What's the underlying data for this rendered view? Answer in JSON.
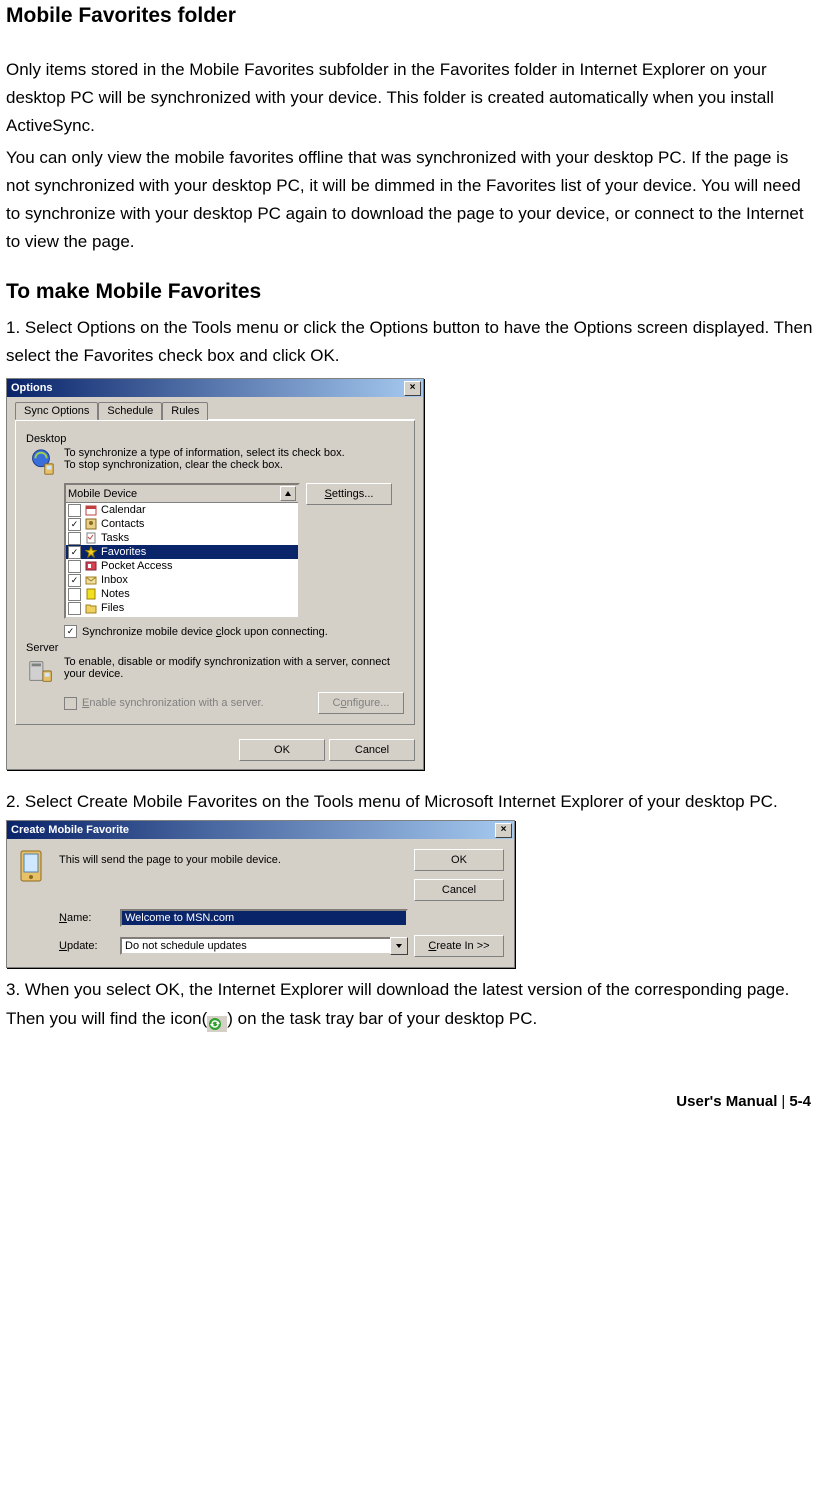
{
  "headings": {
    "title": "Mobile Favorites folder",
    "section2": "To make Mobile Favorites"
  },
  "paragraphs": {
    "p1": "Only items stored in the Mobile Favorites subfolder in the Favorites folder in Internet Explorer on your desktop PC will be synchronized with your device. This folder is created automatically when you install ActiveSync.",
    "p2": "You can only view the mobile favorites offline that was synchronized with your desktop PC. If the page is not synchronized with your desktop PC, it will be dimmed in the Favorites list of your device. You will need to synchronize with your desktop PC again to download the page to your device, or connect to the Internet to view the page.",
    "step1": "1. Select Options on the Tools menu or click the Options button to have the Options screen displayed. Then select the Favorites check box and click OK.",
    "step2": "2. Select Create Mobile Favorites on the Tools menu of Microsoft Internet Explorer of your desktop PC.",
    "step3a": "3. When you select OK, the Internet Explorer will download the latest version of the corresponding page. Then you will find the icon(",
    "step3b": ") on the task tray bar of your desktop PC."
  },
  "optionsDialog": {
    "title": "Options",
    "tabs": [
      "Sync Options",
      "Schedule",
      "Rules"
    ],
    "desktopLabel": "Desktop",
    "desktopText1": "To synchronize a type of information, select its check box.",
    "desktopText2": "To stop synchronization, clear the check box.",
    "listHeader": "Mobile Device",
    "items": [
      {
        "label": "Calendar",
        "checked": false
      },
      {
        "label": "Contacts",
        "checked": true
      },
      {
        "label": "Tasks",
        "checked": false
      },
      {
        "label": "Favorites",
        "checked": true,
        "selected": true
      },
      {
        "label": "Pocket Access",
        "checked": false
      },
      {
        "label": "Inbox",
        "checked": true
      },
      {
        "label": "Notes",
        "checked": false
      },
      {
        "label": "Files",
        "checked": false
      }
    ],
    "settingsBtn": "Settings...",
    "syncClock": "Synchronize mobile device clock upon connecting.",
    "serverLabel": "Server",
    "serverText": "To enable, disable or modify synchronization with a server, connect your device.",
    "enableServer": "Enable synchronization with a server.",
    "configureBtn": "Configure...",
    "okBtn": "OK",
    "cancelBtn": "Cancel"
  },
  "createFavDialog": {
    "title": "Create Mobile Favorite",
    "msg": "This will send the page to your mobile device.",
    "nameLabel": "Name:",
    "nameValue": "Welcome to MSN.com",
    "updateLabel": "Update:",
    "updateValue": "Do not schedule updates",
    "okBtn": "OK",
    "cancelBtn": "Cancel",
    "createInBtn": "Create In >>"
  },
  "footer": {
    "left": "User's Manual",
    "right": "5-4"
  }
}
